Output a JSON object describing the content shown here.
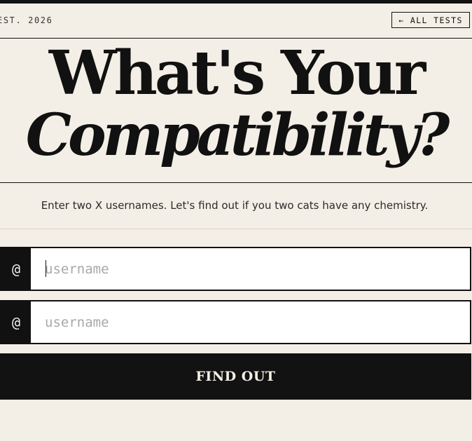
{
  "header": {
    "established": "EST. 2026",
    "back_link": "← ALL TESTS"
  },
  "headline": {
    "line1": "What's Your",
    "line2": "Compatibility?"
  },
  "subtitle": "Enter two X usernames. Let's find out if you two cats have any chemistry.",
  "form": {
    "prefix": "@",
    "username1": {
      "value": "",
      "placeholder": "username",
      "focused": true
    },
    "username2": {
      "value": "",
      "placeholder": "username",
      "focused": false
    },
    "submit_label": "FIND OUT"
  },
  "colors": {
    "background": "#f4efe6",
    "ink": "#111111",
    "input_background": "#ffffff",
    "placeholder": "#a8a8a8"
  }
}
